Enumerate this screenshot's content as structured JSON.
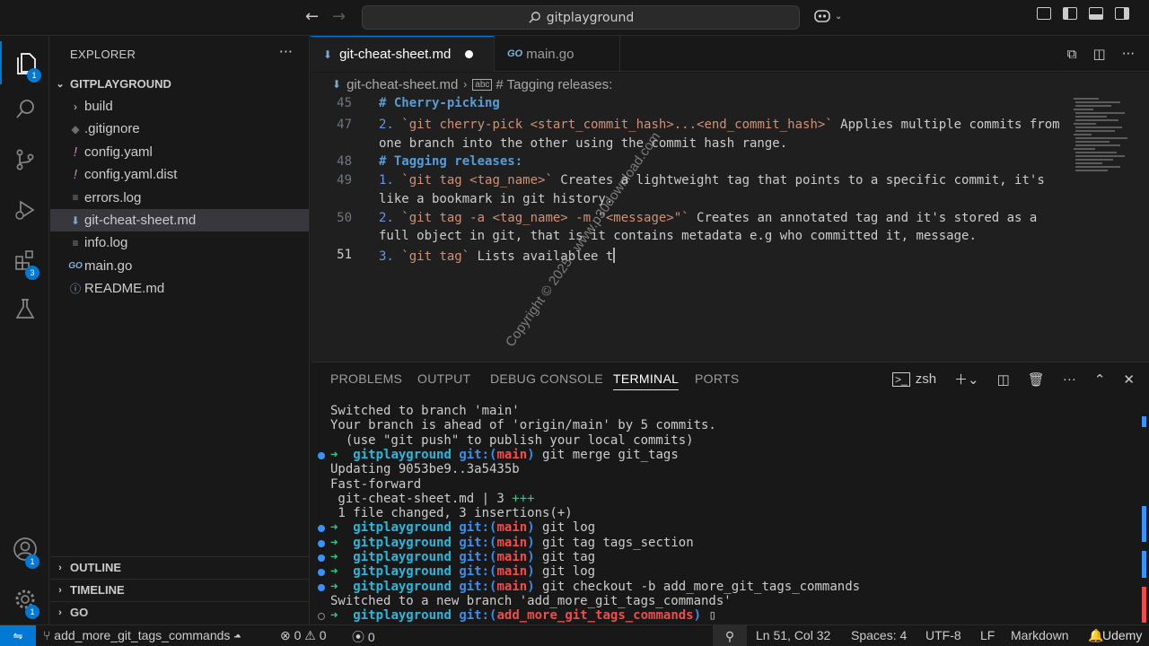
{
  "titlebar": {
    "back": "←",
    "forward": "→",
    "search": "gitplayground"
  },
  "activity": {
    "explorer_badge": "1",
    "extensions_badge": "3",
    "accounts_badge": "1",
    "manage_badge": "1"
  },
  "sidebar": {
    "title": "EXPLORER",
    "more": "···",
    "root": "GITPLAYGROUND",
    "files": [
      {
        "label": "build",
        "icon": "›",
        "type": "folder"
      },
      {
        "label": ".gitignore",
        "icon": "◆",
        "type": "file"
      },
      {
        "label": "config.yaml",
        "icon": "!",
        "type": "file"
      },
      {
        "label": "config.yaml.dist",
        "icon": "!",
        "type": "file"
      },
      {
        "label": "errors.log",
        "icon": "≡",
        "type": "file"
      },
      {
        "label": "git-cheat-sheet.md",
        "icon": "⬇",
        "type": "file"
      },
      {
        "label": "info.log",
        "icon": "≡",
        "type": "file"
      },
      {
        "label": "main.go",
        "icon": "GO",
        "type": "file"
      },
      {
        "label": "README.md",
        "icon": "ⓘ",
        "type": "file"
      }
    ],
    "outline": "OUTLINE",
    "timeline": "TIMELINE",
    "go": "GO"
  },
  "tabs": [
    {
      "label": "git-cheat-sheet.md",
      "icon": "⬇"
    },
    {
      "label": "main.go",
      "icon": "GO"
    }
  ],
  "breadcrumb": {
    "file": "git-cheat-sheet.md",
    "symbol": "# Tagging releases:"
  },
  "editor": {
    "sticky": "# Cherry-picking",
    "lines": [
      {
        "n": "45",
        "text": "# Cherry-picking"
      },
      {
        "n": "47",
        "text": "2. `git cherry-pick <start_commit_hash>...<end_commit_hash>` Applies multiple commits from"
      },
      {
        "n": "",
        "text": "one branch into the other using the commit hash range."
      },
      {
        "n": "48",
        "text": "# Tagging releases:"
      },
      {
        "n": "49",
        "text": "1. `git tag <tag_name>` Creates a lightweight tag that points to a specific commit, it's"
      },
      {
        "n": "",
        "text": "like a bookmark in git history."
      },
      {
        "n": "50",
        "text": "2. `git tag -a <tag_name> -m \"<message>\"` Creates an annotated tag and it's stored as a"
      },
      {
        "n": "",
        "text": "full object in git, that is it contains metadata e.g who committed it, message."
      },
      {
        "n": "51",
        "text": "3. `git tag` Lists availablee t"
      }
    ]
  },
  "watermark": "Copyright © 2025 - www.p30download.com",
  "panel": {
    "tabs": [
      "PROBLEMS",
      "OUTPUT",
      "DEBUG CONSOLE",
      "TERMINAL",
      "PORTS"
    ],
    "shell": "zsh",
    "terminal": [
      {
        "kind": "out",
        "text": "Switched to branch 'main'"
      },
      {
        "kind": "out",
        "text": "Your branch is ahead of 'origin/main' by 5 commits."
      },
      {
        "kind": "out",
        "text": "  (use \"git push\" to publish your local commits)"
      },
      {
        "kind": "prompt",
        "repo": "gitplayground",
        "branch": "main",
        "cmd": "git merge git_tags"
      },
      {
        "kind": "out",
        "text": "Updating 9053be9..3a5435b"
      },
      {
        "kind": "out",
        "text": "Fast-forward"
      },
      {
        "kind": "diff",
        "text": " git-cheat-sheet.md | 3 ",
        "plus": "+++"
      },
      {
        "kind": "out",
        "text": " 1 file changed, 3 insertions(+)"
      },
      {
        "kind": "prompt",
        "repo": "gitplayground",
        "branch": "main",
        "cmd": "git log"
      },
      {
        "kind": "prompt",
        "repo": "gitplayground",
        "branch": "main",
        "cmd": "git tag tags_section"
      },
      {
        "kind": "prompt",
        "repo": "gitplayground",
        "branch": "main",
        "cmd": "git tag"
      },
      {
        "kind": "prompt",
        "repo": "gitplayground",
        "branch": "main",
        "cmd": "git log"
      },
      {
        "kind": "prompt",
        "repo": "gitplayground",
        "branch": "main",
        "cmd": "git checkout -b add_more_git_tags_commands"
      },
      {
        "kind": "out",
        "text": "Switched to a new branch 'add_more_git_tags_commands'"
      },
      {
        "kind": "prompt-last",
        "repo": "gitplayground",
        "branch": "add_more_git_tags_commands",
        "cmd": "▯"
      }
    ]
  },
  "status": {
    "branch": "add_more_git_tags_commands",
    "errors": "0",
    "warnings": "0",
    "ports": "0",
    "position": "Ln 51, Col 32",
    "spaces": "Spaces: 4",
    "encoding": "UTF-8",
    "eol": "LF",
    "language": "Markdown",
    "udemy": "Udemy"
  },
  "colors": {
    "accent": "#0078d4",
    "background": "#1f1f1f",
    "sidebar": "#181818"
  }
}
